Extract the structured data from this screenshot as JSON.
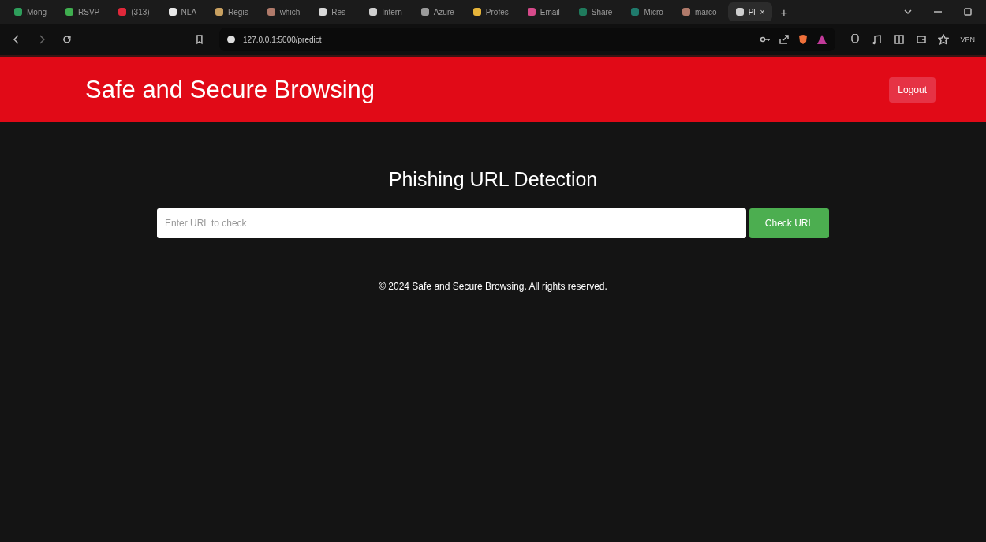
{
  "browser": {
    "tabs": [
      {
        "title": "Mong",
        "color": "#2e9e5b",
        "selected": false
      },
      {
        "title": "RSVP",
        "color": "#3fae4f",
        "selected": false
      },
      {
        "title": "(313)",
        "color": "#e0283a",
        "selected": false
      },
      {
        "title": "NLA",
        "color": "#e8e8e8",
        "selected": false
      },
      {
        "title": "Regis",
        "color": "#c8a060",
        "selected": false
      },
      {
        "title": "which",
        "color": "#b07a6a",
        "selected": false
      },
      {
        "title": "Res -",
        "color": "#d8d8d8",
        "selected": false
      },
      {
        "title": "Intern",
        "color": "#cfcfcf",
        "selected": false
      },
      {
        "title": "Azure",
        "color": "#9a9a9a",
        "selected": false
      },
      {
        "title": "Profes",
        "color": "#e6b43a",
        "selected": false
      },
      {
        "title": "Email",
        "color": "#d64a8a",
        "selected": false
      },
      {
        "title": "Share",
        "color": "#1f7a5c",
        "selected": false
      },
      {
        "title": "Micro",
        "color": "#1f7a6c",
        "selected": false
      },
      {
        "title": "marco",
        "color": "#b07a6a",
        "selected": false
      },
      {
        "title": "Pl",
        "color": "#cfcfcf",
        "selected": true
      }
    ],
    "new_tab": "+",
    "close_tab": "×",
    "url": "127.0.0.1:5000/predict",
    "vpn": "VPN"
  },
  "header": {
    "title": "Safe and Secure Browsing",
    "logout": "Logout"
  },
  "main": {
    "heading": "Phishing URL Detection",
    "url_field": {
      "placeholder": "Enter URL to check"
    },
    "check_button": "Check URL"
  },
  "footer": "© 2024 Safe and Secure Browsing. All rights reserved."
}
